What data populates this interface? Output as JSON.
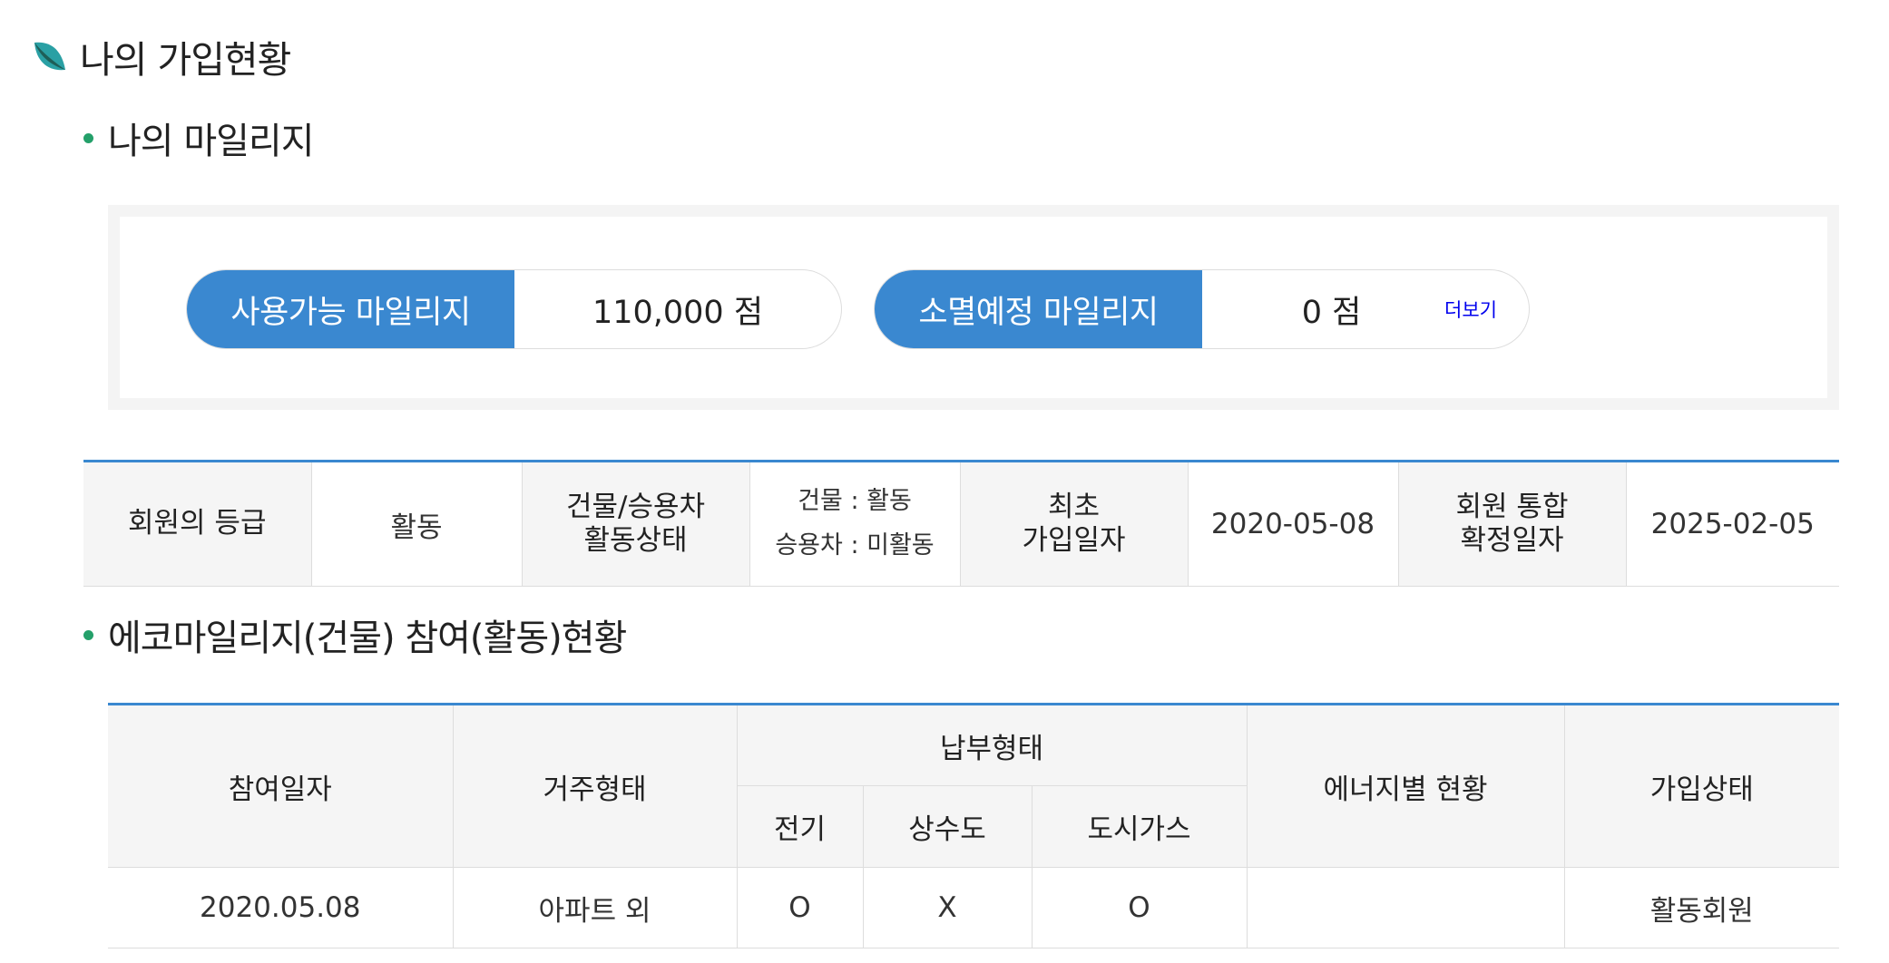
{
  "page_title": "나의 가입현황",
  "section_mileage": {
    "title": "나의 마일리지"
  },
  "mileage": {
    "available": {
      "label": "사용가능 마일리지",
      "value": "110,000 점"
    },
    "expiring": {
      "label": "소멸예정 마일리지",
      "value": "0 점",
      "more": "더보기"
    }
  },
  "grade": {
    "grade_label": "회원의 등급",
    "grade_value": "활동",
    "status_label_1": "건물/승용차",
    "status_label_2": "활동상태",
    "status_building": "건물 : 활동",
    "status_car": "승용차 : 미활동",
    "join_label_1": "최초",
    "join_label_2": "가입일자",
    "join_value": "2020-05-08",
    "confirm_label_1": "회원 통합",
    "confirm_label_2": "확정일자",
    "confirm_value": "2025-02-05"
  },
  "section_eco": {
    "title": "에코마일리지(건물) 참여(활동)현황"
  },
  "eco_table": {
    "headers": {
      "join_date": "참여일자",
      "residence": "거주형태",
      "payment": "납부형태",
      "electric": "전기",
      "water": "상수도",
      "gas": "도시가스",
      "energy": "에너지별 현황",
      "status": "가입상태"
    },
    "rows": [
      {
        "join_date": "2020.05.08",
        "residence": "아파트 외",
        "electric": "O",
        "water": "X",
        "gas": "O",
        "energy": "",
        "status": "활동회원"
      }
    ]
  },
  "colors": {
    "accent": "#3a88d0",
    "leaf_dark": "#1e5e58",
    "leaf_light": "#2aa0a4",
    "dot": "#24a06a"
  }
}
